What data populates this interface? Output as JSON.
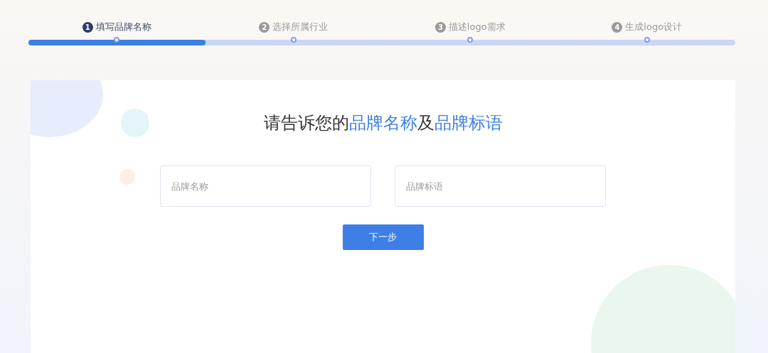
{
  "steps": [
    {
      "number": "1",
      "label": "填写品牌名称",
      "selected": true
    },
    {
      "number": "2",
      "label": "选择所属行业",
      "selected": false
    },
    {
      "number": "3",
      "label": "描述logo需求",
      "selected": false
    },
    {
      "number": "4",
      "label": "生成logo设计",
      "selected": false
    }
  ],
  "progress": {
    "level": 0.25
  },
  "heading": [
    {
      "text": "请告诉您的",
      "highlight": false
    },
    {
      "text": "品牌名称",
      "highlight": true
    },
    {
      "text": "及",
      "highlight": false
    },
    {
      "text": "品牌标语",
      "highlight": true
    }
  ],
  "fields": [
    {
      "placeholder": "品牌名称"
    },
    {
      "placeholder": "品牌标语"
    }
  ],
  "next_button": "下一步"
}
